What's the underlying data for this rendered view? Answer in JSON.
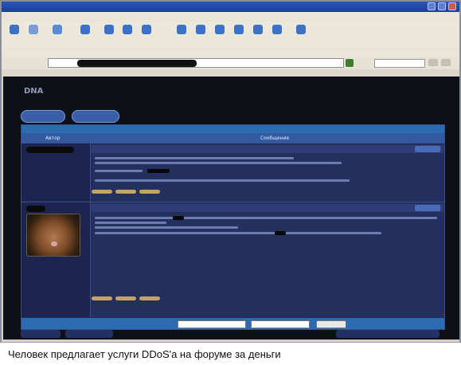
{
  "caption": "Человек предлагает услуги DDoS'a на форуме за деньги",
  "site": {
    "logo": "DNA"
  },
  "forum": {
    "column_author": "Автор",
    "column_message": "Сообщение"
  },
  "colors": {
    "page_bg": "#0e1018",
    "forum_bg": "#1f2a56",
    "header_blue": "#2b6cb0",
    "titlebar_blue": "#2c57b8"
  },
  "icons": [
    "back-icon",
    "forward-icon",
    "stop-icon",
    "refresh-icon",
    "home-icon",
    "search-icon",
    "favorites-icon",
    "history-icon",
    "mail-icon",
    "print-icon",
    "edit-icon"
  ]
}
